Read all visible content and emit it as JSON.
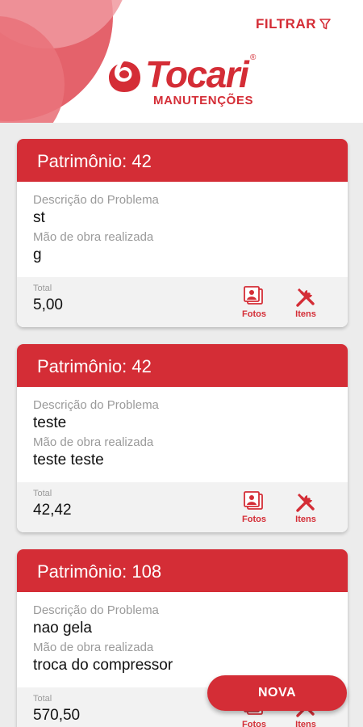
{
  "header": {
    "filter_label": "FILTRAR",
    "brand_name": "Tocari",
    "brand_registered": "®",
    "subtitle": "MANUTENÇÕES"
  },
  "labels": {
    "problem": "Descrição do Problema",
    "labor": "Mão de obra realizada",
    "total": "Total",
    "photos": "Fotos",
    "items": "Itens"
  },
  "cards": [
    {
      "title": "Patrimônio: 42",
      "problem": "st",
      "labor": "g",
      "total": "5,00"
    },
    {
      "title": "Patrimônio: 42",
      "problem": "teste",
      "labor": "teste teste",
      "total": "42,42"
    },
    {
      "title": "Patrimônio: 108",
      "problem": "nao gela",
      "labor": "troca do compressor",
      "total": "570,50"
    }
  ],
  "fab": {
    "label": "NOVA"
  },
  "colors": {
    "accent": "#d42d36",
    "background": "#ececec",
    "footer": "#f2f2f2"
  },
  "icons": [
    "filter-icon",
    "tocari-logo-icon",
    "photos-icon",
    "tools-icon"
  ]
}
